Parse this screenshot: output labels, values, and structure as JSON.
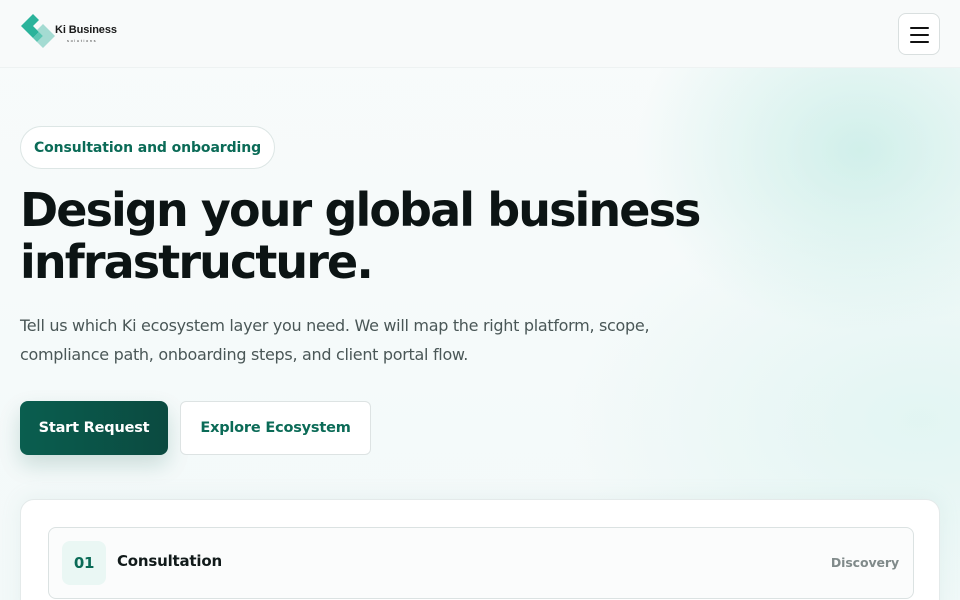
{
  "header": {
    "logo_title": "Ki Business",
    "logo_subtitle": "solutions",
    "colors": {
      "logo_primary": "#2bb39b",
      "logo_secondary": "#9fd9d0"
    },
    "menu_icon": "hamburger-icon"
  },
  "hero": {
    "pill_label": "Consultation and onboarding",
    "headline_line1": "Design your global business",
    "headline_line2": "infrastructure.",
    "subtext_line1": "Tell us which Ki ecosystem layer you need. We will map the right platform, scope,",
    "subtext_line2": "compliance path, onboarding steps, and client portal flow.",
    "primary_button": "Start Request",
    "secondary_button": "Explore Ecosystem",
    "colors": {
      "accent": "#0b6b57",
      "primary_button_bg": "#0a5e4f"
    }
  },
  "process": {
    "steps": [
      {
        "number": "01",
        "title": "Consultation",
        "tag": "Discovery"
      }
    ]
  }
}
